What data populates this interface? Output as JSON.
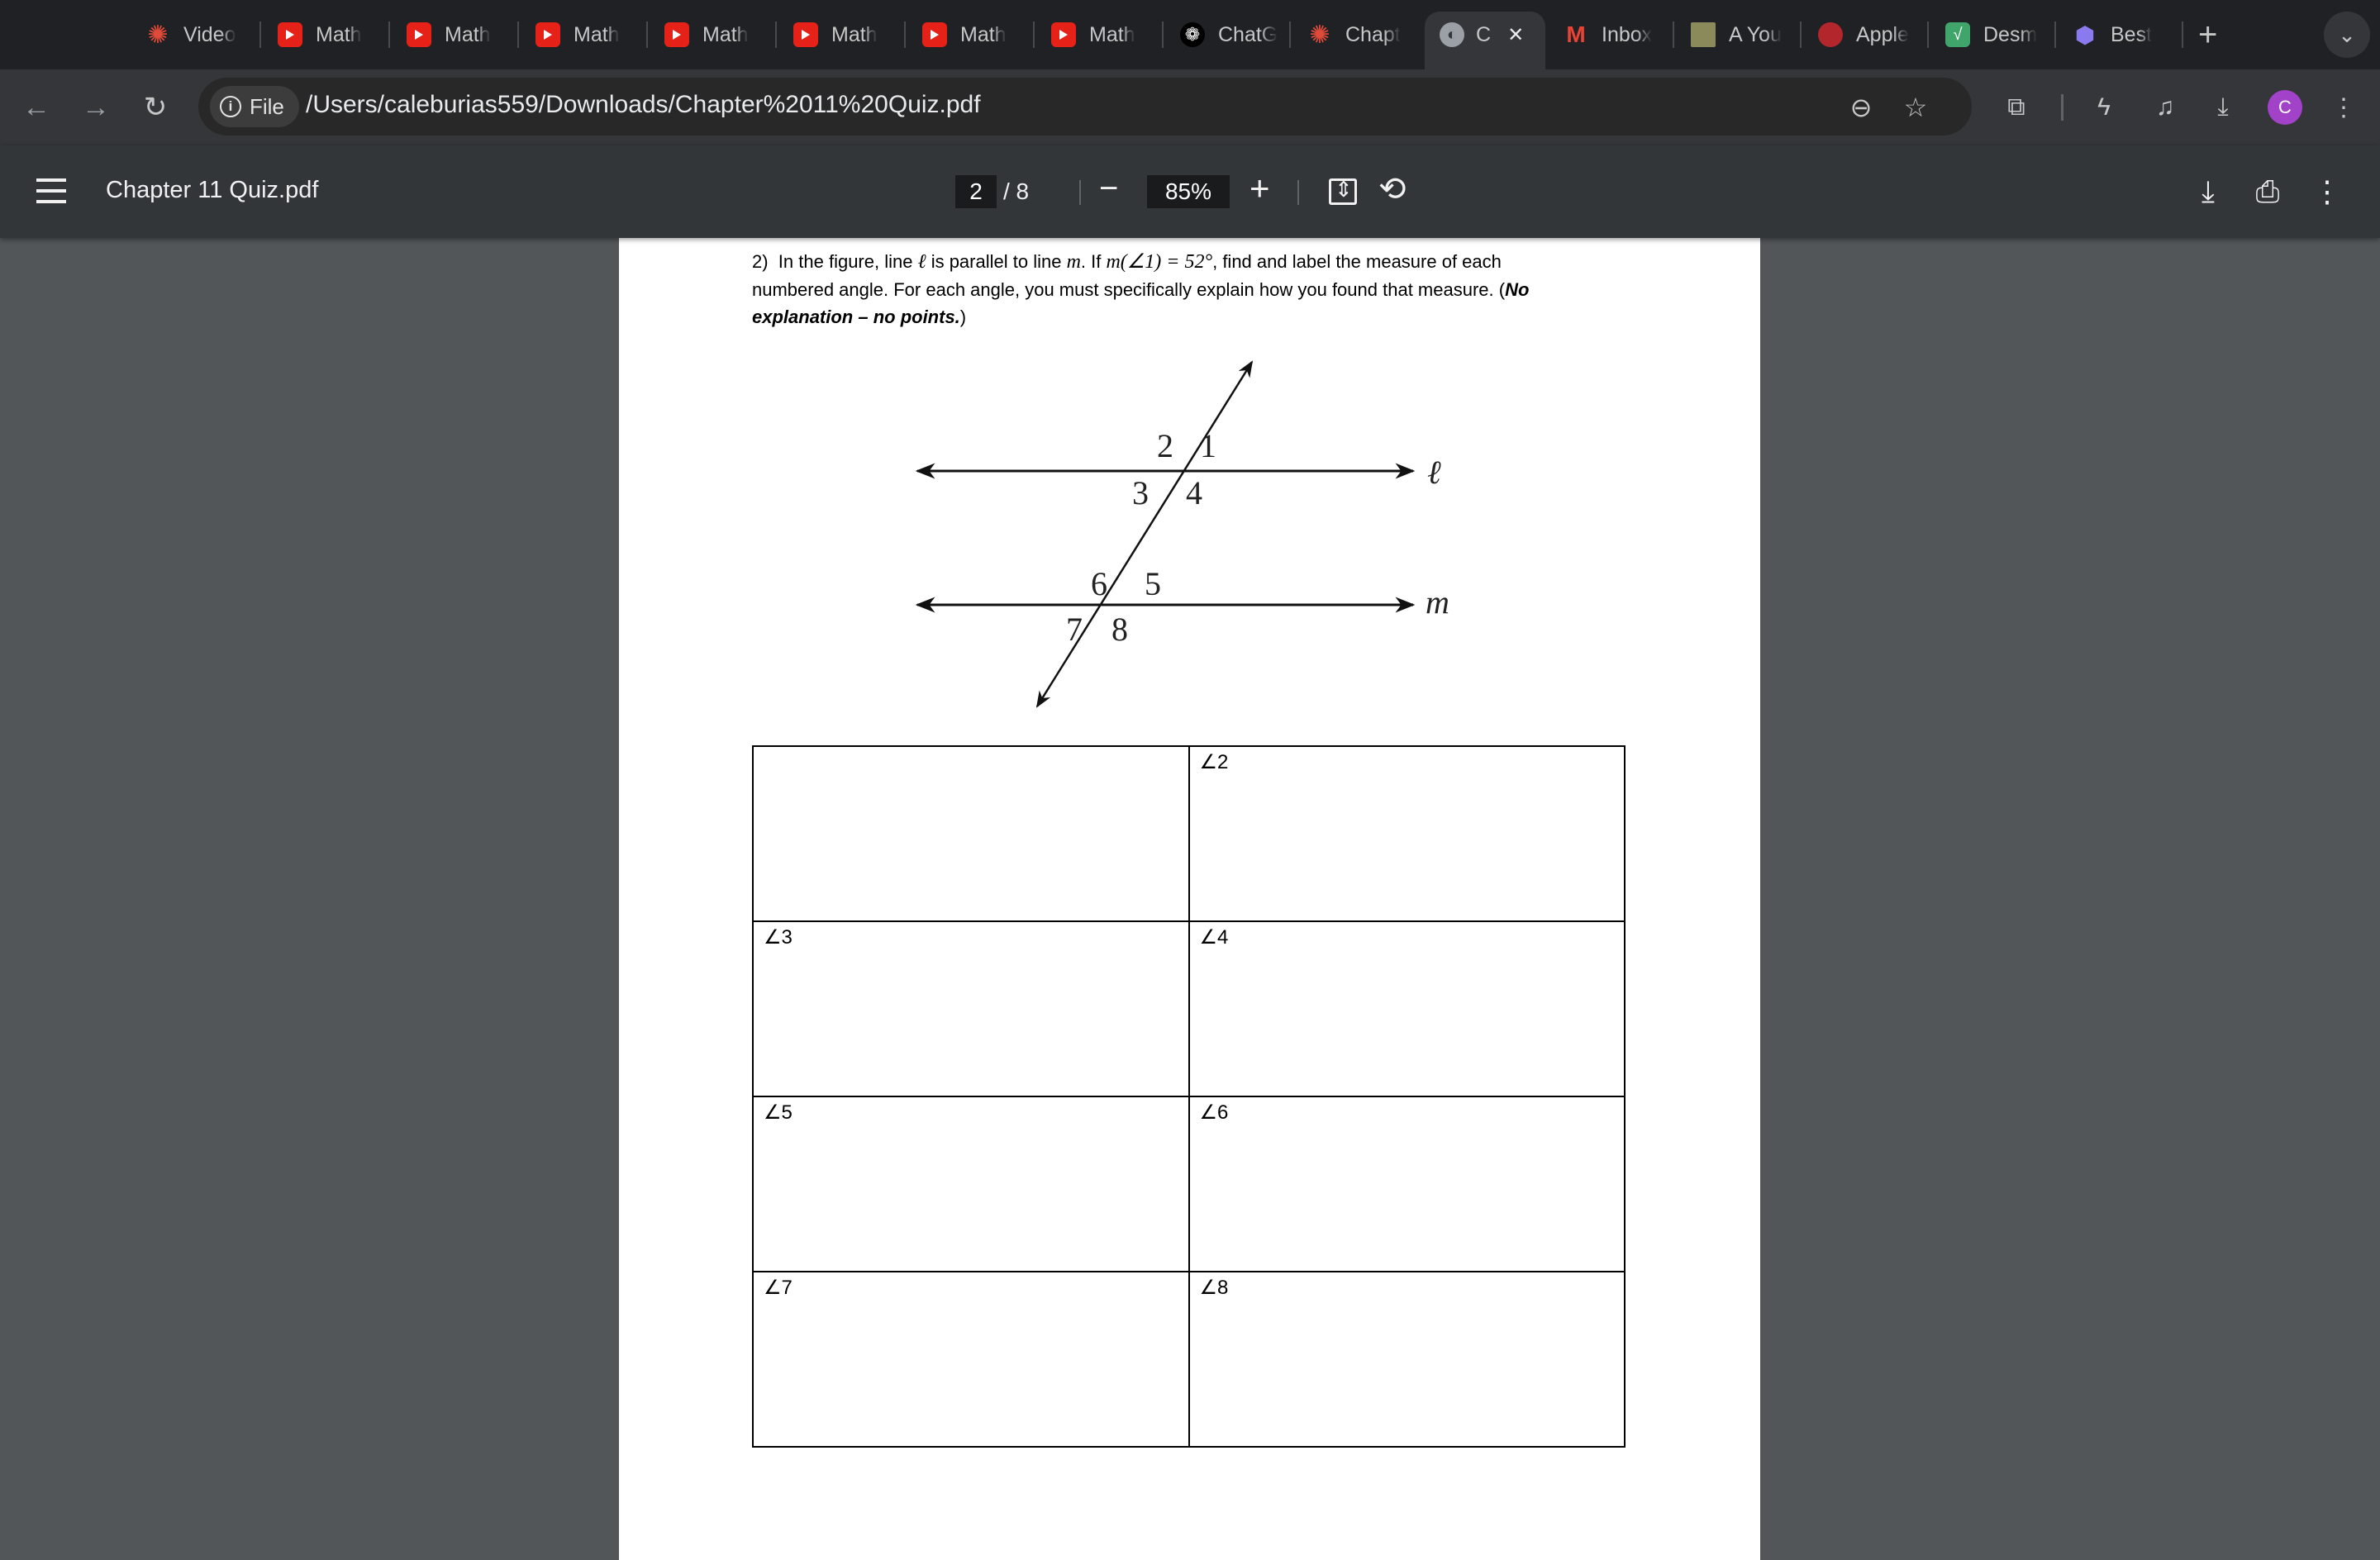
{
  "browser": {
    "tabs": [
      {
        "label": "Video",
        "icon": "canvas-icon"
      },
      {
        "label": "Math",
        "icon": "youtube-icon"
      },
      {
        "label": "Math",
        "icon": "youtube-icon"
      },
      {
        "label": "Math",
        "icon": "youtube-icon"
      },
      {
        "label": "Math",
        "icon": "youtube-icon"
      },
      {
        "label": "Math",
        "icon": "youtube-icon"
      },
      {
        "label": "Math",
        "icon": "youtube-icon"
      },
      {
        "label": "Math",
        "icon": "youtube-icon"
      },
      {
        "label": "ChatG",
        "icon": "chatgpt-icon"
      },
      {
        "label": "Chapt",
        "icon": "canvas-icon"
      },
      {
        "label": "C",
        "icon": "globe-icon",
        "active": true
      },
      {
        "label": "Inbox",
        "icon": "gmail-icon"
      },
      {
        "label": "A You",
        "icon": "image-thumb-icon"
      },
      {
        "label": "Apple",
        "icon": "apple-icon"
      },
      {
        "label": "Desm",
        "icon": "desmos-icon"
      },
      {
        "label": "Best",
        "icon": "gem-icon"
      }
    ],
    "new_tab": "+",
    "close": "✕",
    "address": {
      "chip_label": "File",
      "url": "/Users/caleburias559/Downloads/Chapter%2011%20Quiz.pdf"
    },
    "avatar_letter": "C",
    "colors": {
      "avatar": "#a142c8",
      "tabstrip": "#202124",
      "toolbar": "#35363a"
    }
  },
  "pdf_viewer": {
    "title": "Chapter 11 Quiz.pdf",
    "current_page": "2",
    "total_pages": "/  8",
    "zoom": "85%"
  },
  "document": {
    "question_num": "2)",
    "q_part1": "In the figure, line ",
    "line_l": "ℓ",
    "q_part2": " is parallel to line ",
    "line_m": "m",
    "q_part3": ". If ",
    "given": "m(∠1) = 52°",
    "q_part4": ", find and label the measure of each numbered angle. For each angle, you must specifically explain how you found that measure. (",
    "note": "No explanation – no points.",
    "q_part5": ")",
    "figure": {
      "angle_labels": [
        "1",
        "2",
        "3",
        "4",
        "5",
        "6",
        "7",
        "8"
      ],
      "line_labels": [
        "ℓ",
        "m"
      ]
    },
    "table": [
      [
        "",
        "∠2"
      ],
      [
        "∠3",
        "∠4"
      ],
      [
        "∠5",
        "∠6"
      ],
      [
        "∠7",
        "∠8"
      ]
    ]
  }
}
